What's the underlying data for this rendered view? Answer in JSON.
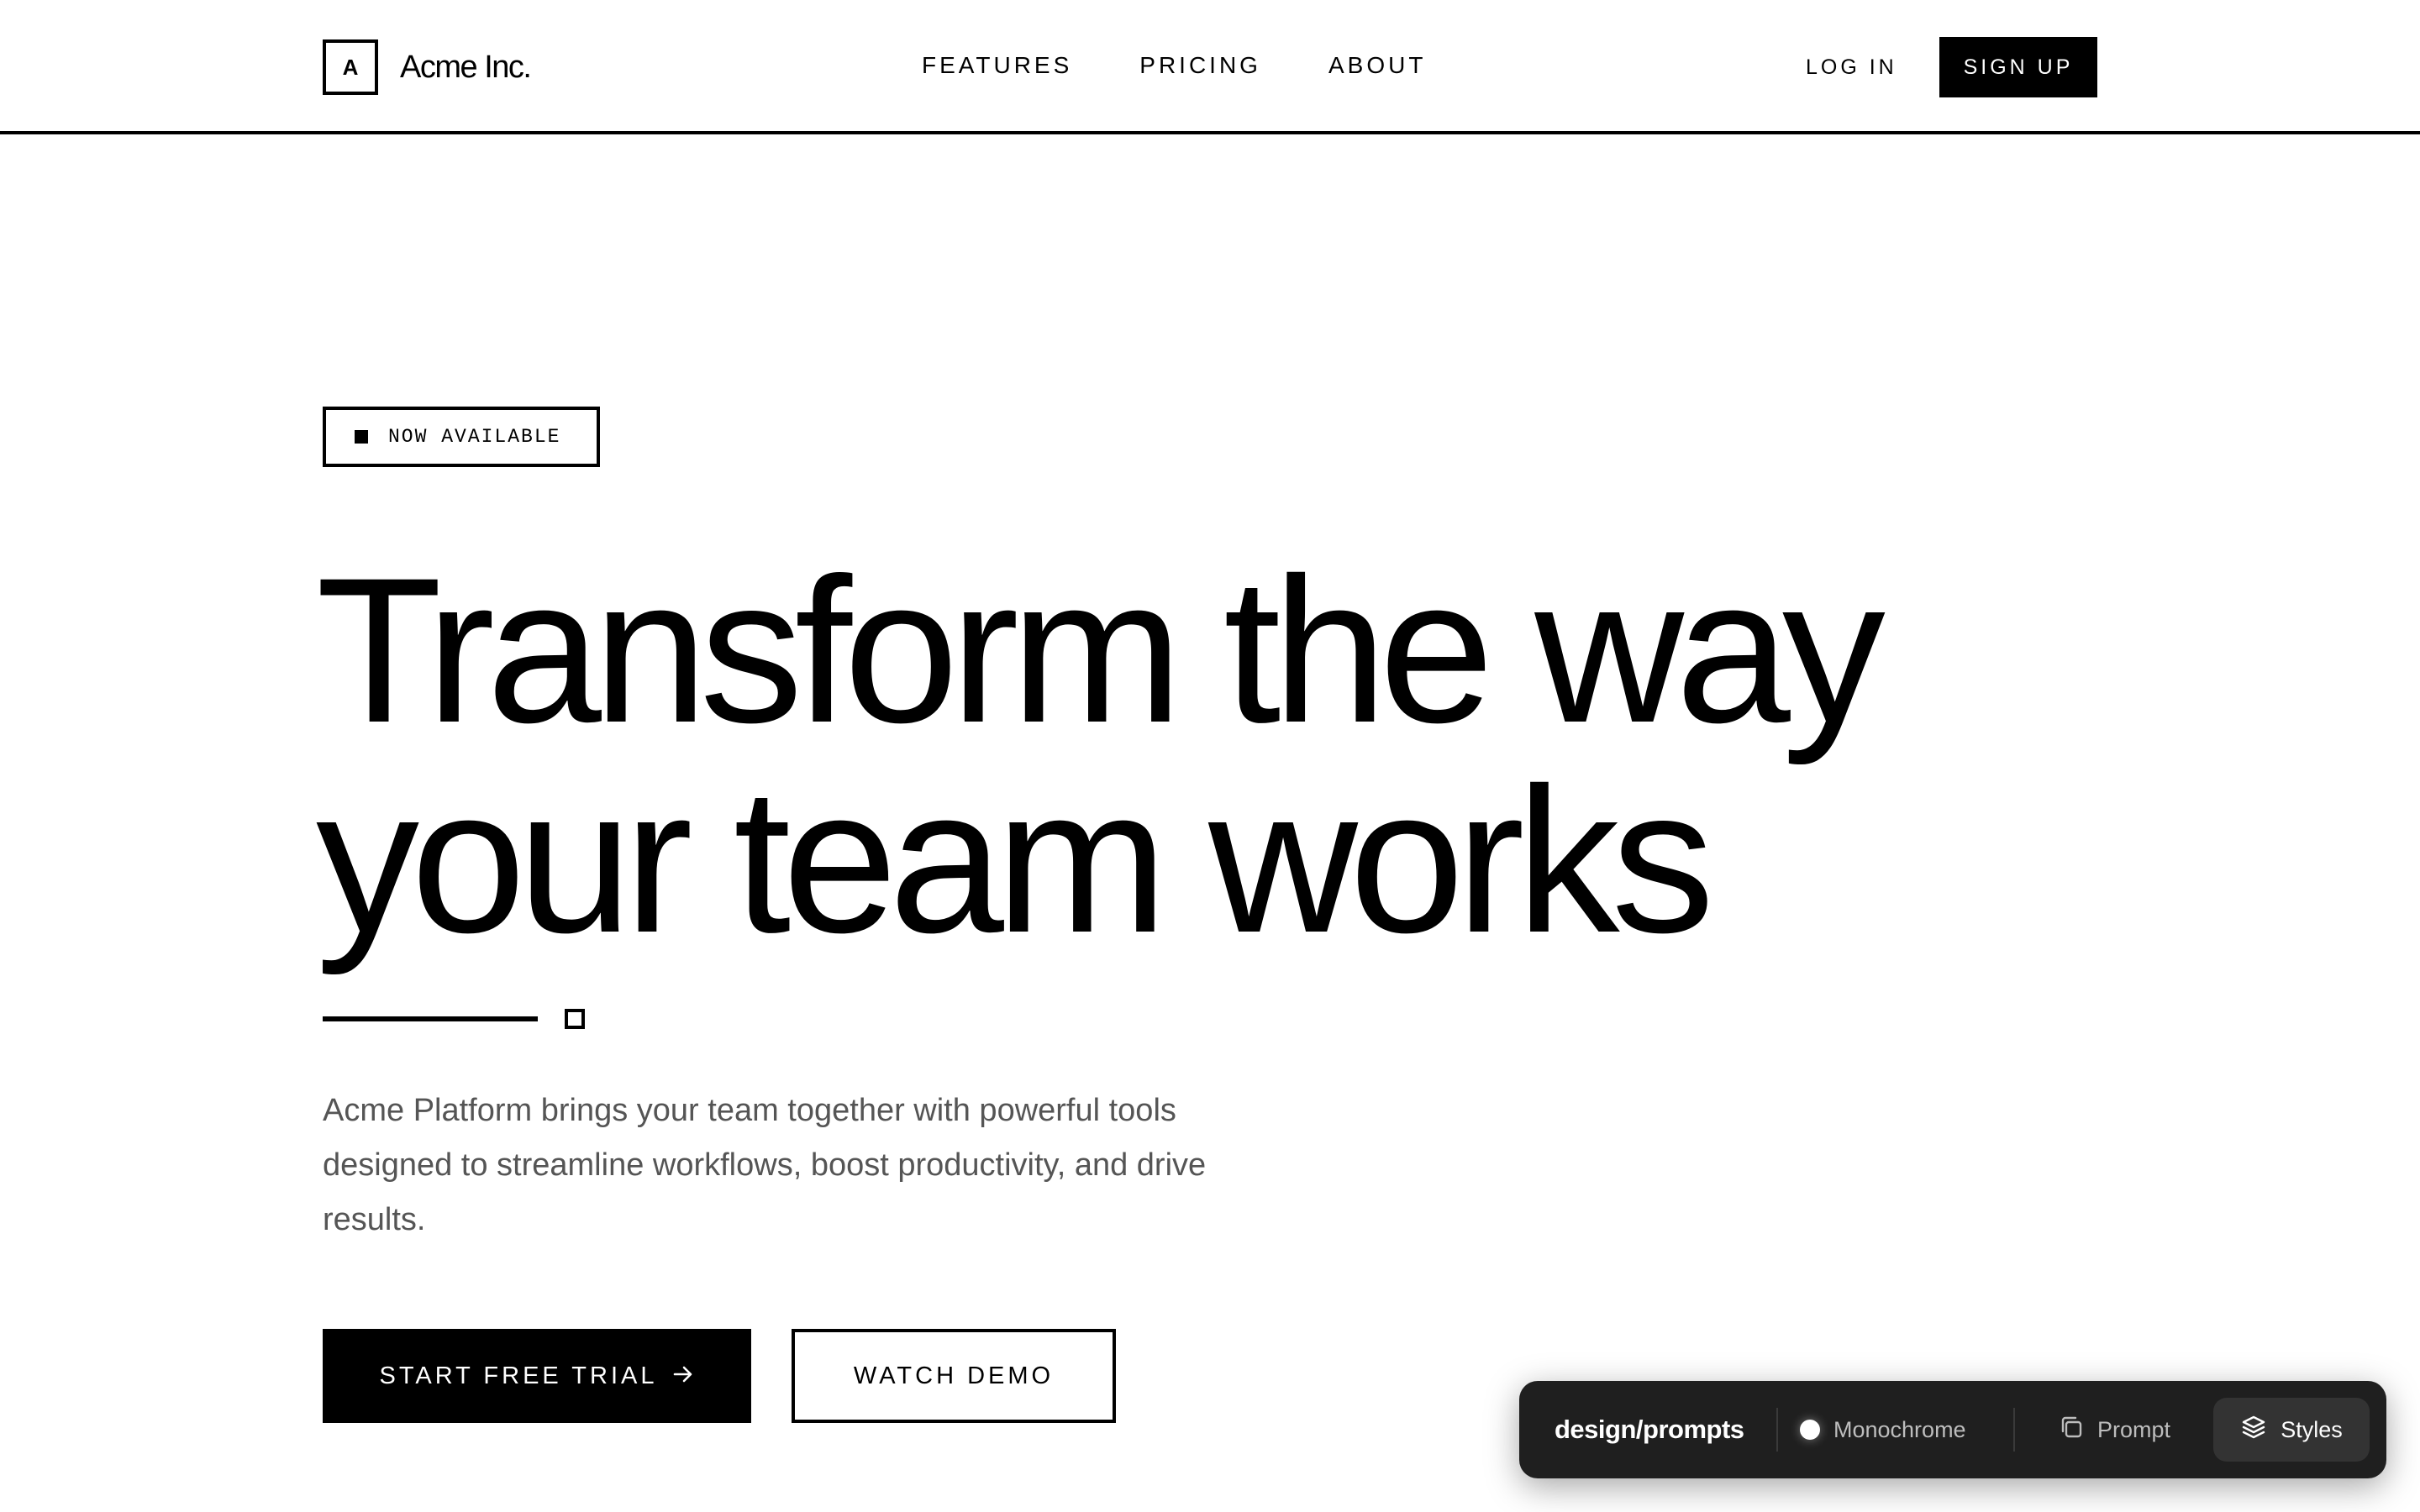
{
  "header": {
    "logo_letter": "A",
    "logo_text": "Acme Inc.",
    "nav": [
      {
        "label": "FEATURES"
      },
      {
        "label": "PRICING"
      },
      {
        "label": "ABOUT"
      }
    ],
    "login_label": "LOG IN",
    "signup_label": "SIGN UP"
  },
  "hero": {
    "badge_text": "NOW AVAILABLE",
    "headline_line1": "Transform the way",
    "headline_line2": "your team works",
    "subtext": "Acme Platform brings your team together with powerful tools designed to streamline workflows, boost productivity, and drive results.",
    "primary_cta": "START FREE TRIAL",
    "secondary_cta": "WATCH DEMO"
  },
  "toolbar": {
    "title": "design/prompts",
    "monochrome_label": "Monochrome",
    "prompt_label": "Prompt",
    "styles_label": "Styles"
  },
  "icons": {
    "primary_cta_icon": "arrow-right-icon",
    "monochrome_icon": "dot-icon",
    "prompt_icon": "copy-icon",
    "styles_icon": "layers-icon"
  },
  "colors": {
    "primary": "#000000",
    "background": "#ffffff",
    "toolbar_bg": "#1f1f1f",
    "subtext": "#555555"
  }
}
